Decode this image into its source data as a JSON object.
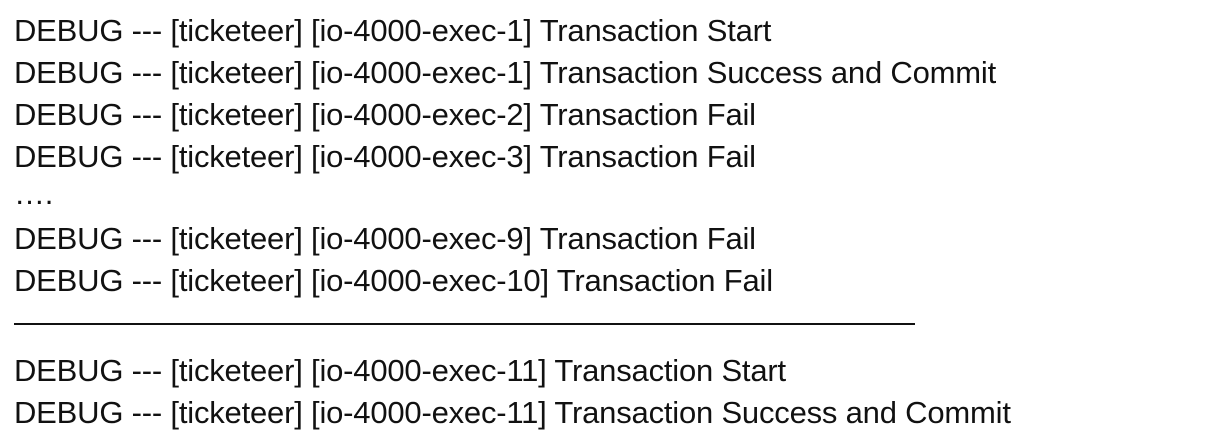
{
  "log": {
    "lines": [
      "DEBUG --- [ticketeer] [io-4000-exec-1] Transaction Start",
      "DEBUG --- [ticketeer] [io-4000-exec-1] Transaction Success and Commit",
      "DEBUG --- [ticketeer] [io-4000-exec-2] Transaction Fail",
      "DEBUG --- [ticketeer] [io-4000-exec-3] Transaction Fail",
      "….",
      "DEBUG --- [ticketeer] [io-4000-exec-9] Transaction Fail",
      "DEBUG --- [ticketeer] [io-4000-exec-10] Transaction Fail",
      "——————————————————————————————",
      "DEBUG --- [ticketeer] [io-4000-exec-11] Transaction Start",
      "DEBUG --- [ticketeer] [io-4000-exec-11] Transaction Success and Commit"
    ]
  }
}
